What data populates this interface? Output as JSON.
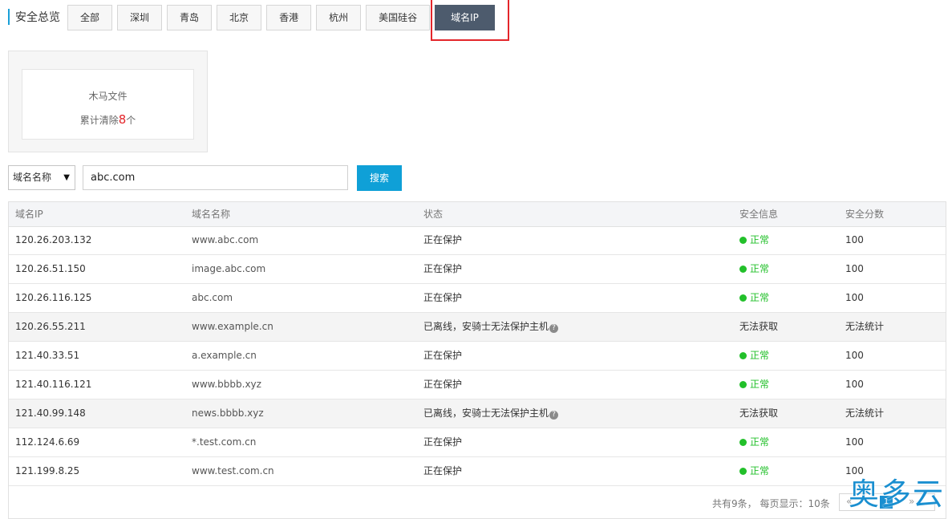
{
  "header": {
    "title": "安全总览",
    "tabs": [
      {
        "label": "全部",
        "active": false
      },
      {
        "label": "深圳",
        "active": false
      },
      {
        "label": "青岛",
        "active": false
      },
      {
        "label": "北京",
        "active": false
      },
      {
        "label": "香港",
        "active": false
      },
      {
        "label": "杭州",
        "active": false
      },
      {
        "label": "美国硅谷",
        "active": false
      },
      {
        "label": "域名IP",
        "active": true
      }
    ]
  },
  "stat": {
    "label": "木马文件",
    "prefix": "累计清除",
    "count": "8",
    "suffix": "个"
  },
  "search": {
    "field_select": "域名名称",
    "value": "abc.com",
    "button": "搜索"
  },
  "table": {
    "columns": [
      "域名IP",
      "域名名称",
      "状态",
      "安全信息",
      "安全分数"
    ],
    "rows": [
      {
        "ip": "120.26.203.132",
        "domain": "www.abc.com",
        "status": "正在保护",
        "info": "正常",
        "score": "100",
        "online": true
      },
      {
        "ip": "120.26.51.150",
        "domain": "image.abc.com",
        "status": "正在保护",
        "info": "正常",
        "score": "100",
        "online": true
      },
      {
        "ip": "120.26.116.125",
        "domain": "abc.com",
        "status": "正在保护",
        "info": "正常",
        "score": "100",
        "online": true
      },
      {
        "ip": "120.26.55.211",
        "domain": "www.example.cn",
        "status": "已离线，安骑士无法保护主机",
        "info": "无法获取",
        "score": "无法统计",
        "online": false
      },
      {
        "ip": "121.40.33.51",
        "domain": "a.example.cn",
        "status": "正在保护",
        "info": "正常",
        "score": "100",
        "online": true
      },
      {
        "ip": "121.40.116.121",
        "domain": "www.bbbb.xyz",
        "status": "正在保护",
        "info": "正常",
        "score": "100",
        "online": true
      },
      {
        "ip": "121.40.99.148",
        "domain": "news.bbbb.xyz",
        "status": "已离线，安骑士无法保护主机",
        "info": "无法获取",
        "score": "无法统计",
        "online": false
      },
      {
        "ip": "112.124.6.69",
        "domain": "*.test.com.cn",
        "status": "正在保护",
        "info": "正常",
        "score": "100",
        "online": true
      },
      {
        "ip": "121.199.8.25",
        "domain": "www.test.com.cn",
        "status": "正在保护",
        "info": "正常",
        "score": "100",
        "online": true
      }
    ]
  },
  "footer": {
    "summary": "共有9条，  每页显示：10条",
    "prev": "«",
    "page": "1",
    "next": "»"
  },
  "watermark": "奥多云",
  "colors": {
    "accent": "#0fa0d7",
    "active_tab": "#4d5b6d",
    "highlight": "#e4262b",
    "ok": "#22c02a"
  }
}
